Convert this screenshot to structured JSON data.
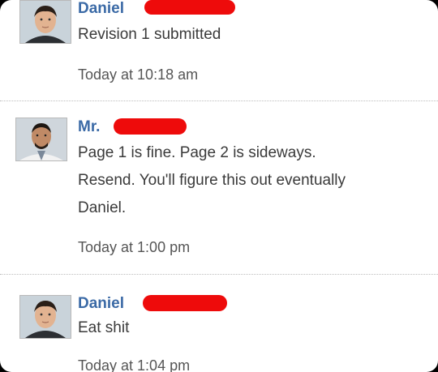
{
  "posts": [
    {
      "author": "Daniel",
      "lines": [
        "Revision 1 submitted"
      ],
      "timestamp": "Today at 10:18 am",
      "avatar": "student-avatar"
    },
    {
      "author": "Mr.",
      "lines": [
        "Page 1 is fine. Page 2 is sideways.",
        "Resend. You'll figure this out eventually",
        "Daniel."
      ],
      "timestamp": "Today at 1:00 pm",
      "avatar": "teacher-avatar"
    },
    {
      "author": "Daniel",
      "lines": [
        "Eat shit"
      ],
      "timestamp": "Today at 1:04 pm",
      "avatar": "student-avatar"
    }
  ],
  "colors": {
    "author": "#3b6aa6",
    "redaction": "#ee0b0b",
    "text": "#3a3a3a",
    "timestamp": "#555555",
    "divider": "#bdbdbd"
  }
}
